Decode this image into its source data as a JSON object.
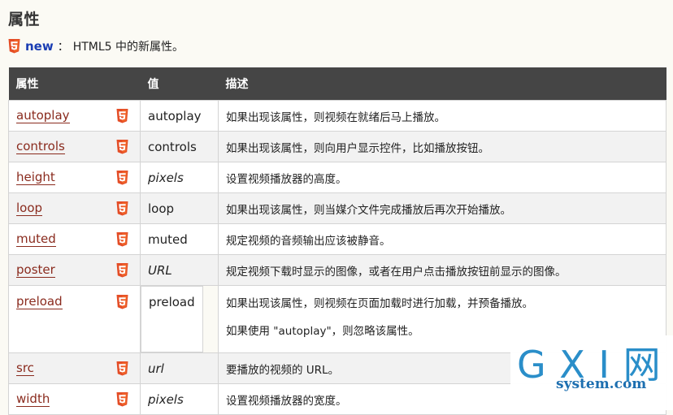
{
  "heading": "属性",
  "new_note": {
    "label": "new",
    "colon": "：",
    "text": "HTML5 中的新属性。"
  },
  "table": {
    "headers": [
      "属性",
      "值",
      "描述"
    ],
    "rows": [
      {
        "name": "autoplay",
        "value": "autoplay",
        "value_italic": false,
        "desc": "如果出现该属性，则视频在就绪后马上播放。"
      },
      {
        "name": "controls",
        "value": "controls",
        "value_italic": false,
        "desc": "如果出现该属性，则向用户显示控件，比如播放按钮。"
      },
      {
        "name": "height",
        "value": "pixels",
        "value_italic": true,
        "desc": "设置视频播放器的高度。"
      },
      {
        "name": "loop",
        "value": "loop",
        "value_italic": false,
        "desc": "如果出现该属性，则当媒介文件完成播放后再次开始播放。"
      },
      {
        "name": "muted",
        "value": "muted",
        "value_italic": false,
        "desc": "规定视频的音频输出应该被静音。"
      },
      {
        "name": "poster",
        "value": "URL",
        "value_italic": true,
        "desc": "规定视频下载时显示的图像，或者在用户点击播放按钮前显示的图像。"
      },
      {
        "name": "preload",
        "value": "preload",
        "value_italic": false,
        "desc": "如果出现该属性，则视频在页面加载时进行加载，并预备播放。",
        "desc2": "如果使用 \"autoplay\"，则忽略该属性。"
      },
      {
        "name": "src",
        "value": "url",
        "value_italic": true,
        "desc": "要播放的视频的 URL。"
      },
      {
        "name": "width",
        "value": "pixels",
        "value_italic": true,
        "desc": "设置视频播放器的宽度。"
      }
    ]
  },
  "watermark": {
    "big": "G X I 网",
    "small": "system.com"
  },
  "colors": {
    "header_bg": "#454545",
    "link": "#8a2b1e",
    "new_label": "#1a3db3",
    "html5_badge": "#e44d26"
  },
  "icons": {
    "html5_badge": "html5-icon"
  }
}
